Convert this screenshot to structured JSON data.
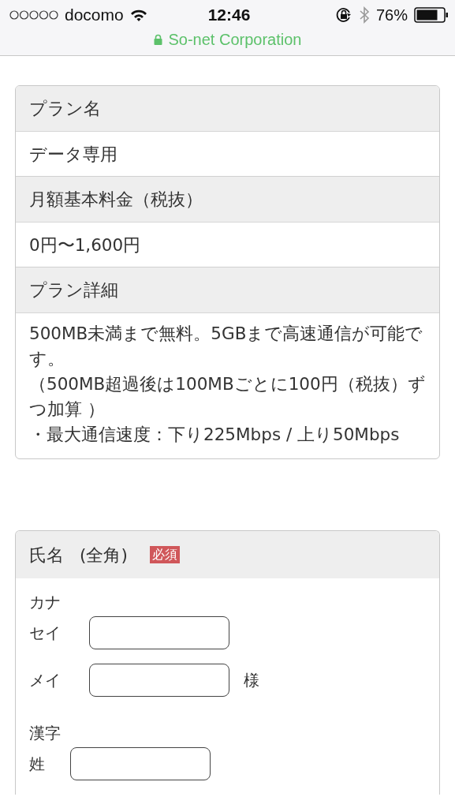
{
  "status_bar": {
    "carrier": "docomo",
    "time": "12:46",
    "battery": "76%"
  },
  "address_bar": {
    "site": "So-net Corporation",
    "secure": true
  },
  "plan_card": {
    "rows": [
      {
        "kind": "header",
        "text": "プラン名"
      },
      {
        "kind": "value",
        "text": "データ専用"
      },
      {
        "kind": "header",
        "text": "月額基本料金（税抜）"
      },
      {
        "kind": "value",
        "text": "0円〜1,600円"
      },
      {
        "kind": "header",
        "text": "プラン詳細"
      },
      {
        "kind": "detail",
        "lines": [
          "500MB未満まで無料。5GBまで高速通信が可能です。",
          "（500MB超過後は100MBごとに100円（税抜）ずつ加算 ）",
          "・最大通信速度：下り225Mbps / 上り50Mbps"
        ]
      }
    ]
  },
  "name_card": {
    "title": "氏名",
    "note": "(全角)",
    "required_badge": "必須",
    "groups": [
      {
        "label": "カナ",
        "fields": [
          {
            "label": "セイ"
          },
          {
            "label": "メイ",
            "suffix": "様"
          }
        ]
      },
      {
        "label": "漢字",
        "fields": [
          {
            "label": "姓"
          }
        ]
      }
    ]
  }
}
